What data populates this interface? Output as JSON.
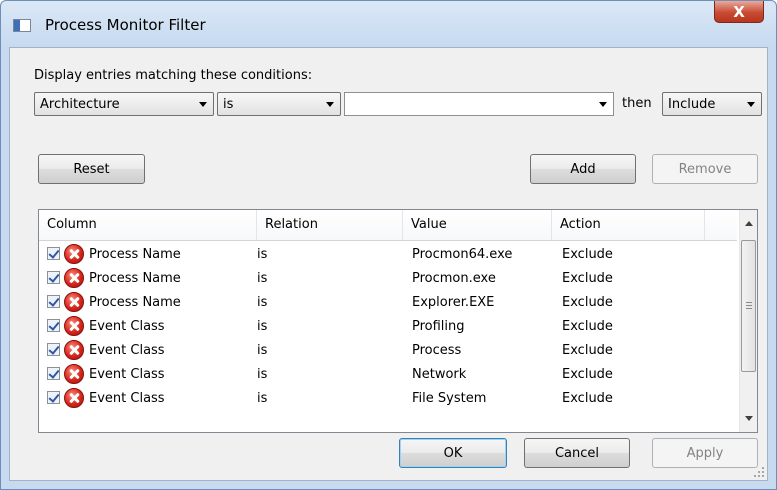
{
  "window": {
    "title": "Process Monitor Filter",
    "close_glyph": "X"
  },
  "conditions": {
    "label": "Display entries matching these conditions:",
    "column_value": "Architecture",
    "relation_value": "is",
    "value_text": "",
    "then_label": "then",
    "action_value": "Include"
  },
  "buttons": {
    "reset": "Reset",
    "add": "Add",
    "remove": "Remove",
    "ok": "OK",
    "cancel": "Cancel",
    "apply": "Apply"
  },
  "table": {
    "headers": [
      "Column",
      "Relation",
      "Value",
      "Action"
    ],
    "rows": [
      {
        "column": "Process Name",
        "relation": "is",
        "value": "Procmon64.exe",
        "action": "Exclude",
        "checked": true
      },
      {
        "column": "Process Name",
        "relation": "is",
        "value": "Procmon.exe",
        "action": "Exclude",
        "checked": true
      },
      {
        "column": "Process Name",
        "relation": "is",
        "value": "Explorer.EXE",
        "action": "Exclude",
        "checked": true
      },
      {
        "column": "Event Class",
        "relation": "is",
        "value": "Profiling",
        "action": "Exclude",
        "checked": true
      },
      {
        "column": "Event Class",
        "relation": "is",
        "value": "Process",
        "action": "Exclude",
        "checked": true
      },
      {
        "column": "Event Class",
        "relation": "is",
        "value": "Network",
        "action": "Exclude",
        "checked": true
      },
      {
        "column": "Event Class",
        "relation": "is",
        "value": "File System",
        "action": "Exclude",
        "checked": true
      }
    ]
  },
  "icons": {
    "app": "process-monitor-icon",
    "row": "red-x-exclude-icon",
    "checkbox": "checkbox-checked"
  },
  "colors": {
    "title_gradient": "#dbe8f6",
    "close_button": "#c84b32",
    "exclude_icon": "#d6261a",
    "checkbox_mark": "#2c5aa6"
  }
}
